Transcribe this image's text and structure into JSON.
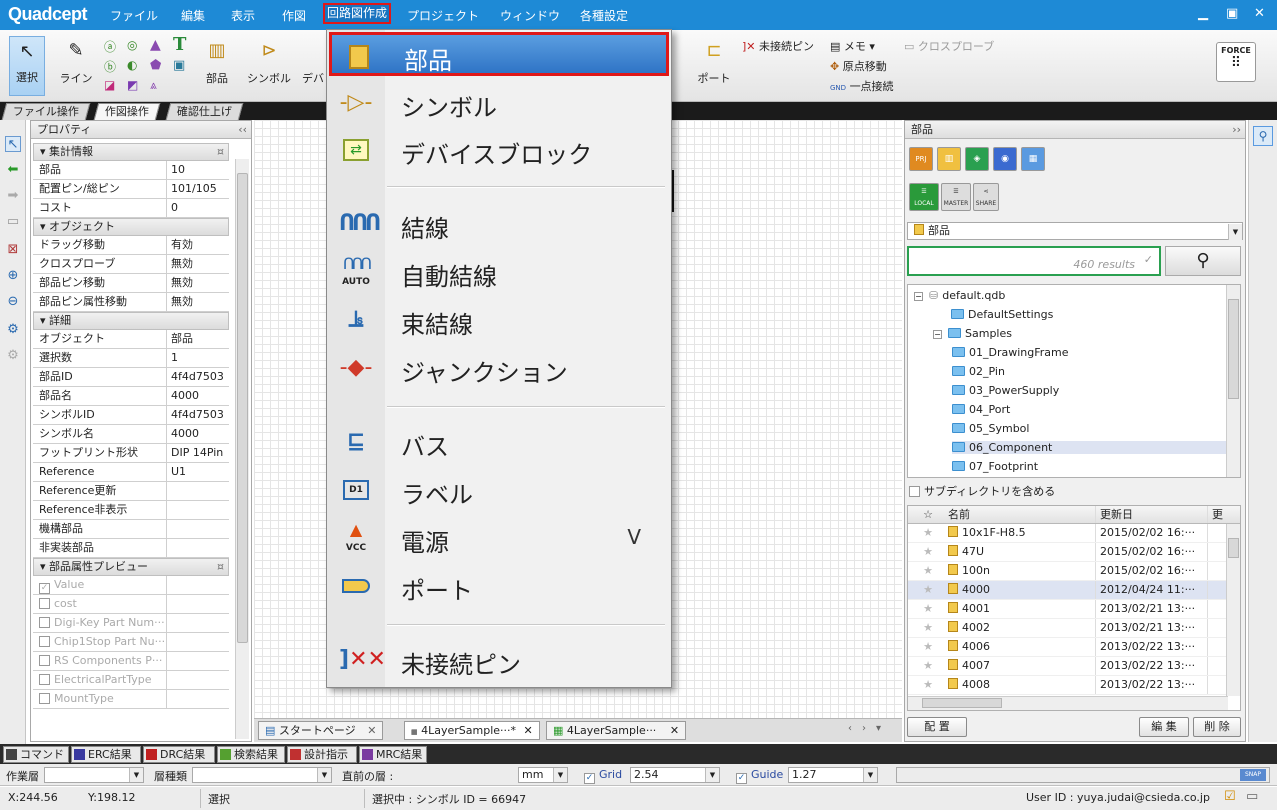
{
  "app": {
    "title": "Quadcept"
  },
  "menubar": {
    "items": [
      "ファイル",
      "編集",
      "表示",
      "作図",
      "回路図作成",
      "プロジェクト",
      "ウィンドウ",
      "各種設定"
    ],
    "highlighted": "回路図作成"
  },
  "ribbon": {
    "select": "選択",
    "line": "ライン",
    "part": "部品",
    "symbol": "シンボル",
    "device": "デバ",
    "port": "ポート",
    "unconnected_pin": "未接続ピン",
    "memo": "メモ",
    "origin": "原点移動",
    "one_point": "一点接続",
    "cross_probe": "クロスプローブ",
    "force": "FORCE",
    "gnd": "GND"
  },
  "tabs": [
    "ファイル操作",
    "作図操作",
    "確認仕上げ"
  ],
  "properties": {
    "title": "プロパティ",
    "sections": {
      "summary": "集計情報",
      "object": "オブジェクト",
      "detail": "詳細",
      "preview": "部品属性プレビュー"
    },
    "summary_rows": [
      {
        "k": "部品",
        "v": "10"
      },
      {
        "k": "配置ピン/総ピン",
        "v": "101/105"
      },
      {
        "k": "コスト",
        "v": "0"
      }
    ],
    "object_rows": [
      {
        "k": "ドラッグ移動",
        "v": "有効"
      },
      {
        "k": "クロスプローブ",
        "v": "無効"
      },
      {
        "k": "部品ピン移動",
        "v": "無効"
      },
      {
        "k": "部品ピン属性移動",
        "v": "無効"
      }
    ],
    "detail_rows": [
      {
        "k": "オブジェクト",
        "v": "部品"
      },
      {
        "k": "選択数",
        "v": "1"
      },
      {
        "k": "部品ID",
        "v": "4f4d7503"
      },
      {
        "k": "部品名",
        "v": "4000"
      },
      {
        "k": "シンボルID",
        "v": "4f4d7503"
      },
      {
        "k": "シンボル名",
        "v": "4000"
      },
      {
        "k": "フットプリント形状",
        "v": "DIP 14Pin"
      },
      {
        "k": "Reference",
        "v": "U1"
      },
      {
        "k": "Reference更新",
        "v": ""
      },
      {
        "k": "Reference非表示",
        "v": ""
      },
      {
        "k": "機構部品",
        "v": ""
      },
      {
        "k": "非実装部品",
        "v": ""
      }
    ],
    "preview_rows": [
      "Value",
      "cost",
      "Digi-Key Part Num···",
      "Chip1Stop Part Nu···",
      "RS Components P···",
      "ElectricalPartType",
      "MountType"
    ]
  },
  "menu": {
    "items": [
      {
        "label": "部品",
        "icon": "part-icon",
        "highlighted": true
      },
      {
        "label": "シンボル",
        "icon": "symbol-icon"
      },
      {
        "label": "デバイスブロック",
        "icon": "device-block-icon"
      },
      {
        "label": "結線",
        "icon": "wire-icon"
      },
      {
        "label": "自動結線",
        "icon": "auto-wire-icon"
      },
      {
        "label": "束結線",
        "icon": "bundle-wire-icon"
      },
      {
        "label": "ジャンクション",
        "icon": "junction-icon"
      },
      {
        "label": "バス",
        "icon": "bus-icon"
      },
      {
        "label": "ラベル",
        "icon": "label-icon"
      },
      {
        "label": "電源",
        "icon": "power-icon",
        "shortcut": "V"
      },
      {
        "label": "ポート",
        "icon": "port-icon"
      },
      {
        "label": "未接続ピン",
        "icon": "unconnected-pin-icon"
      }
    ],
    "icon_text": {
      "auto": "AUTO",
      "vcc": "VCC",
      "d1": "D1"
    }
  },
  "doctabs": [
    "スタートページ",
    "4LayerSample···*",
    "4LayerSample···"
  ],
  "parts_panel": {
    "title": "部品",
    "lib_buttons": [
      "PRJ",
      "LOCAL",
      "MASTER",
      "SHARE"
    ],
    "combo": "部品",
    "search_placeholder": "460 results",
    "tree": [
      {
        "label": "default.qdb",
        "depth": 0,
        "type": "db"
      },
      {
        "label": "DefaultSettings",
        "depth": 1
      },
      {
        "label": "Samples",
        "depth": 1
      },
      {
        "label": "01_DrawingFrame",
        "depth": 2
      },
      {
        "label": "02_Pin",
        "depth": 2
      },
      {
        "label": "03_PowerSupply",
        "depth": 2
      },
      {
        "label": "04_Port",
        "depth": 2
      },
      {
        "label": "05_Symbol",
        "depth": 2
      },
      {
        "label": "06_Component",
        "depth": 2,
        "selected": true
      },
      {
        "label": "07_Footprint",
        "depth": 2
      }
    ],
    "include_sub": "サブディレクトリを含める",
    "columns": [
      "☆",
      "名前",
      "更新日",
      "更"
    ],
    "rows": [
      {
        "name": "10x1F-H8.5",
        "date": "2015/02/02 16:···"
      },
      {
        "name": "47U",
        "date": "2015/02/02 16:···"
      },
      {
        "name": "100n",
        "date": "2015/02/02 16:···"
      },
      {
        "name": "4000",
        "date": "2012/04/24 11:···",
        "selected": true
      },
      {
        "name": "4001",
        "date": "2013/02/21 13:···"
      },
      {
        "name": "4002",
        "date": "2013/02/21 13:···"
      },
      {
        "name": "4006",
        "date": "2013/02/22 13:···"
      },
      {
        "name": "4007",
        "date": "2013/02/22 13:···"
      },
      {
        "name": "4008",
        "date": "2013/02/22 13:···"
      }
    ],
    "place": "配 置",
    "edit": "編 集",
    "delete": "削 除"
  },
  "bottom_tabs": [
    {
      "label": "コマンド",
      "color": "#444444"
    },
    {
      "label": "ERC結果",
      "color": "#3a3aa0"
    },
    {
      "label": "DRC結果",
      "color": "#c02020"
    },
    {
      "label": "検索結果",
      "color": "#55a030"
    },
    {
      "label": "設計指示",
      "color": "#c03030"
    },
    {
      "label": "MRC結果",
      "color": "#7a3aa0"
    }
  ],
  "options": {
    "work_layer": "作業層",
    "layer_type": "層種類",
    "prev_layer": "直前の層 :",
    "unit": "mm",
    "grid_label": "Grid",
    "grid": "2.54",
    "guide_label": "Guide",
    "guide": "1.27",
    "snap": "SNAP"
  },
  "status": {
    "x": "X:244.56",
    "y": "Y:198.12",
    "mode": "選択",
    "selection": "選択中 : シンボル ID = 66947",
    "user": "User ID : yuya.judai@csieda.co.jp"
  },
  "colors": {
    "menubar": "#1e8ad6",
    "highlight_border": "#e01818",
    "menu_highlight": "#2f74c6"
  }
}
